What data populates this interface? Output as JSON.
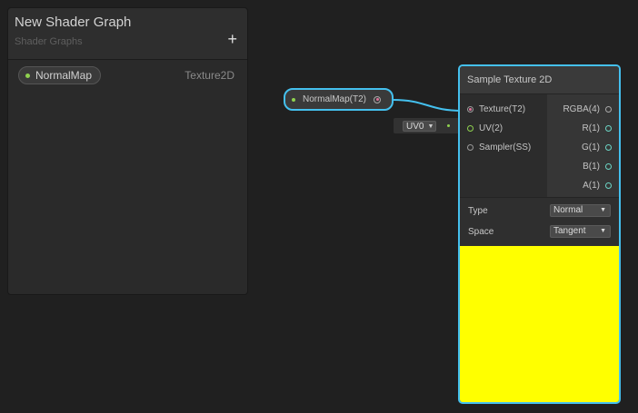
{
  "blackboard": {
    "title": "New Shader Graph",
    "subtitle": "Shader Graphs",
    "add_icon": "+",
    "properties": [
      {
        "name": "NormalMap",
        "type": "Texture2D"
      }
    ]
  },
  "property_node": {
    "label": "NormalMap(T2)"
  },
  "uv_inline": {
    "value": "UV0",
    "arrow": "▼"
  },
  "sample_texture_node": {
    "title": "Sample Texture 2D",
    "inputs": [
      "Texture(T2)",
      "UV(2)",
      "Sampler(SS)"
    ],
    "outputs": [
      "RGBA(4)",
      "R(1)",
      "G(1)",
      "B(1)",
      "A(1)"
    ],
    "settings": {
      "type_label": "Type",
      "type_value": "Normal",
      "space_label": "Space",
      "space_value": "Tangent"
    },
    "preview_color": "#ffff00"
  },
  "colors": {
    "selection": "#44c0ee",
    "vector_port": "#8fd14f",
    "texture_port": "#e0729a",
    "output_port": "#6cd6c6"
  }
}
